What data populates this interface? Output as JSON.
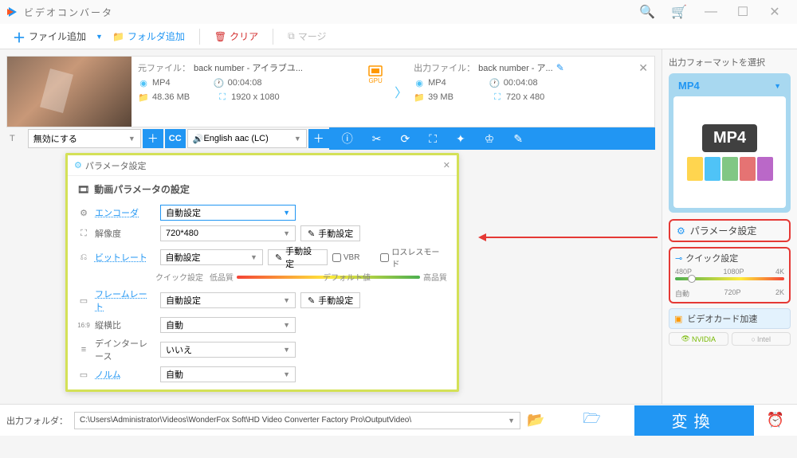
{
  "app": {
    "title": "ビデオコンバータ"
  },
  "toolbar": {
    "add_file": "ファイル追加",
    "add_folder": "フォルダ追加",
    "clear": "クリア",
    "merge": "マージ"
  },
  "card": {
    "src_label": "元ファイル：",
    "src_name": "back number - アイラブユ...",
    "out_label": "出力ファイル：",
    "out_name": "back number - ア...",
    "src_fmt": "MP4",
    "src_dur": "00:04:08",
    "src_size": "48.36 MB",
    "src_res": "1920 x 1080",
    "out_fmt": "MP4",
    "out_dur": "00:04:08",
    "out_size": "39 MB",
    "out_res": "720 x 480",
    "gpu": "GPU"
  },
  "ribbon": {
    "disable": "無効にする",
    "lang": "English aac (LC)"
  },
  "dialog": {
    "title": "パラメータ設定",
    "section": "動画パラメータの設定",
    "encoder_lbl": "エンコーダ",
    "encoder_val": "自動設定",
    "resolution_lbl": "解像度",
    "resolution_val": "720*480",
    "bitrate_lbl": "ビットレート",
    "bitrate_val": "自動設定",
    "manual": "手動設定",
    "vbr": "VBR",
    "lossless": "ロスレスモード",
    "quick": "クイック設定",
    "low_q": "低品質",
    "default_q": "デフォルト値",
    "high_q": "高品質",
    "fps_lbl": "フレームレート",
    "fps_val": "自動設定",
    "aspect_lbl": "縦横比",
    "aspect_val": "自動",
    "deint_lbl": "デインターレース",
    "deint_val": "いいえ",
    "norm_lbl": "ノルム",
    "norm_val": "自動"
  },
  "right": {
    "fmt_title": "出力フォーマットを選択",
    "fmt_name": "MP4",
    "fmt_badge": "MP4",
    "param_btn": "パラメータ設定",
    "quick_title": "クイック設定",
    "slider_top": [
      "480P",
      "1080P",
      "4K"
    ],
    "slider_bot": [
      "自動",
      "720P",
      "2K"
    ],
    "gpu_accel": "ビデオカード加速",
    "nvidia": "NVIDIA",
    "intel": "Intel"
  },
  "bottom": {
    "out_lbl": "出力フォルダ：",
    "out_path": "C:\\Users\\Administrator\\Videos\\WonderFox Soft\\HD Video Converter Factory Pro\\OutputVideo\\",
    "convert": "変換"
  }
}
